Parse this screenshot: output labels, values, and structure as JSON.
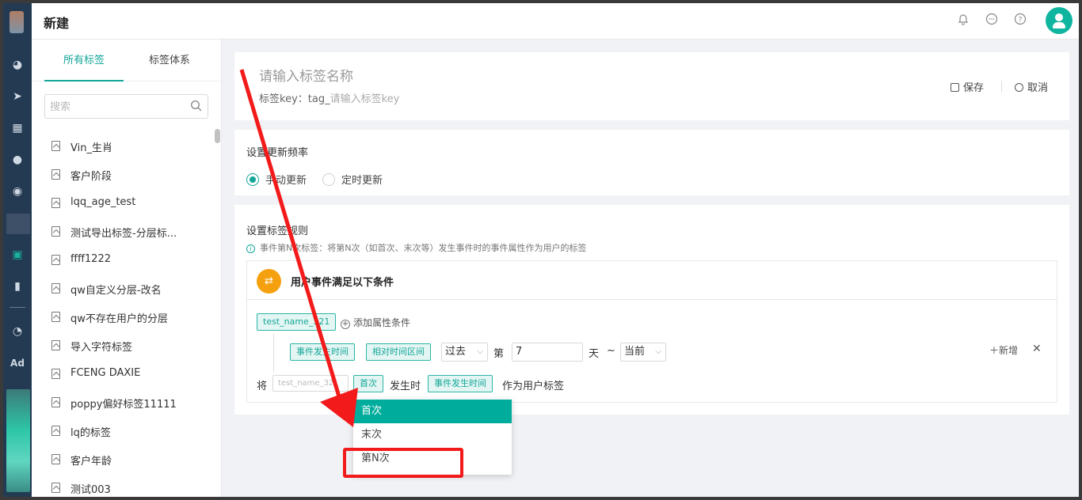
{
  "header": {
    "title": "新建"
  },
  "sidebar": {
    "tabs": [
      {
        "label": "所有标签"
      },
      {
        "label": "标签体系"
      }
    ],
    "search_placeholder": "搜索",
    "items": [
      {
        "label": "Vin_生肖"
      },
      {
        "label": "客户阶段"
      },
      {
        "label": "lqq_age_test"
      },
      {
        "label": "测试导出标签-分层标..."
      },
      {
        "label": "ffff1222"
      },
      {
        "label": "qw自定义分层-改名"
      },
      {
        "label": "qw不存在用户的分层"
      },
      {
        "label": "导入字符标签"
      },
      {
        "label": "FCENG DAXIE"
      },
      {
        "label": "poppy偏好标签11111"
      },
      {
        "label": "lq的标签"
      },
      {
        "label": "客户年龄"
      },
      {
        "label": "测试003"
      }
    ]
  },
  "tag_header": {
    "name_placeholder": "请输入标签名称",
    "key_prefix": "标签key：tag_",
    "key_placeholder": "请输入标签key",
    "save_label": "保存",
    "cancel_label": "取消"
  },
  "update_freq": {
    "title": "设置更新频率",
    "options": [
      {
        "label": "手动更新",
        "selected": true
      },
      {
        "label": "定时更新",
        "selected": false
      }
    ]
  },
  "rules": {
    "title": "设置标签规则",
    "hint": "事件第N次标签：将第N次（如首次、末次等）发生事件时的事件属性作为用户的标签",
    "condition_title": "用户事件满足以下条件",
    "event_chip": "test_name_321",
    "add_attr_label": "添加属性条件",
    "filter": {
      "attr_chip": "事件发生时间",
      "range_chip": "相对时间区间",
      "past_select": "过去",
      "nth_label": "第",
      "days_value": "7",
      "day_unit": "天",
      "tilde": "~",
      "current_select": "当前",
      "new_label": "新增",
      "close_symbol": "✕"
    },
    "final": {
      "prefix": "将",
      "dim_placeholder": "test_name_321",
      "order_chip": "首次",
      "when_text": "发生时",
      "attr_chip": "事件发生时间",
      "suffix": "作为用户标签"
    }
  },
  "dropdown": {
    "options": [
      {
        "label": "首次",
        "selected": true
      },
      {
        "label": "末次",
        "selected": false
      },
      {
        "label": "第N次",
        "selected": false
      }
    ]
  },
  "annotation": {
    "highlight_color": "#f21a1a"
  },
  "colors": {
    "accent": "#13a698",
    "rail": "#233a52",
    "orange": "#f5a10f"
  }
}
